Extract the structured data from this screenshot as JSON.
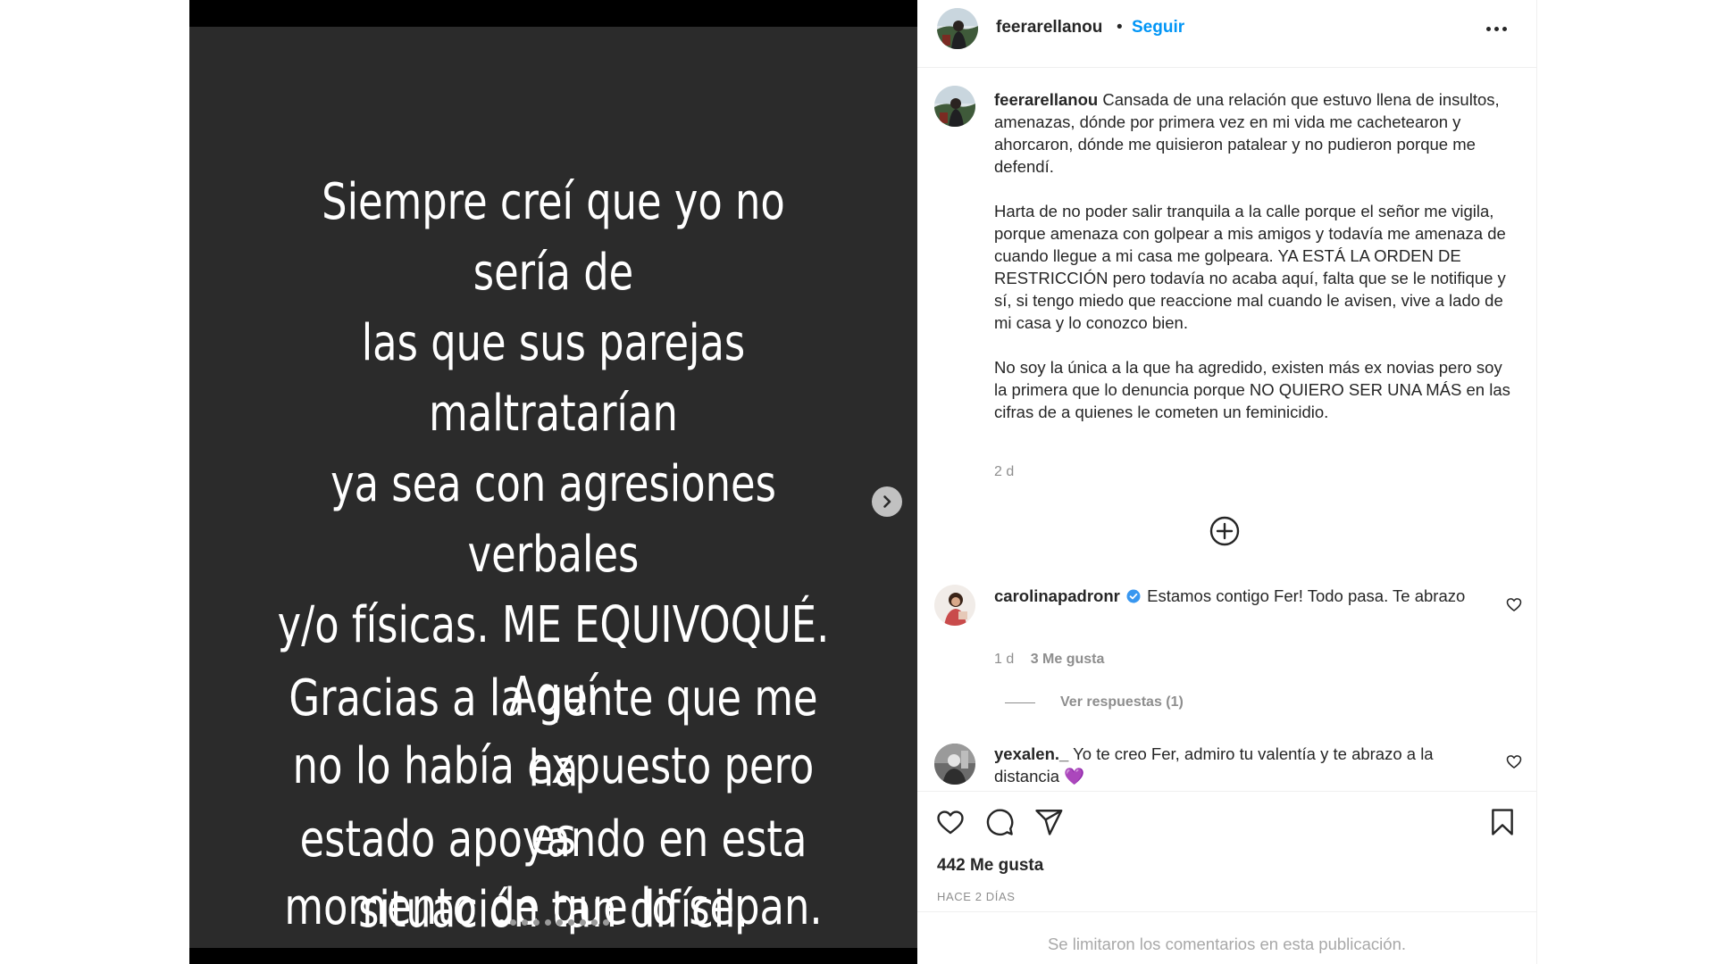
{
  "story": {
    "paragraph1": "Siempre creí que yo no sería de\nlas que sus parejas maltratarían\nya sea con agresiones verbales\ny/o físicas. ME EQUIVOQUÉ. Aquí\nno lo había expuesto pero es\nmomento de que lo sepan.",
    "paragraph2": "Gracias a la gente que me ha\nestado apoyando en esta\nsituación tan difícil.",
    "slide_count": 10,
    "active_slide": 1
  },
  "header": {
    "username": "feerarellanou",
    "separator": "•",
    "follow_label": "Seguir"
  },
  "caption": {
    "username": "feerarellanou",
    "paragraph1": "Cansada de una relación que estuvo llena de insultos, amenazas, dónde por primera vez en mi vida me cachetearon y ahorcaron, dónde me quisieron patalear y no pudieron porque me defendí.",
    "paragraph2": "Harta de no poder salir tranquila a la calle porque el señor me vigila, porque amenaza con golpear a mis amigos y todavía me amenaza de cuando llegue a mi casa me golpeara. YA ESTÁ LA ORDEN DE RESTRICCIÓN pero todavía no acaba aquí, falta que se le notifique y sí, si tengo miedo que reaccione mal cuando le avisen, vive a lado de mi casa y lo conozco bien.",
    "paragraph3": "No soy la única a la que ha agredido, existen más ex novias pero soy la primera que lo denuncia porque NO QUIERO SER UNA MÁS en las cifras de a quienes le cometen un feminicidio.",
    "time": "2 d"
  },
  "comments": [
    {
      "username": "carolinapadronr",
      "verified": true,
      "text": "Estamos contigo Fer! Todo pasa. Te abrazo",
      "time": "1 d",
      "likes": "3 Me gusta",
      "replies_label": "Ver respuestas (1)"
    },
    {
      "username": "yexalen._",
      "text": "Yo te creo Fer, admiro tu valentía y te abrazo a la distancia 💜"
    }
  ],
  "footer": {
    "likes": "442 Me gusta",
    "date": "HACE 2 DÍAS",
    "comments_limited": "Se limitaron los comentarios en esta publicación."
  },
  "colors": {
    "story_background": "#2b2b2b",
    "link_blue": "#0095f6",
    "muted_text": "#8e8e8e",
    "verified_blue": "#3897f0"
  },
  "icons": {
    "next": "chevron-right-icon",
    "more": "more-options-icon",
    "load_more": "plus-circle-icon",
    "like": "heart-icon",
    "comment": "comment-bubble-icon",
    "share": "paper-plane-icon",
    "save": "bookmark-icon",
    "verified": "verified-badge-icon"
  }
}
